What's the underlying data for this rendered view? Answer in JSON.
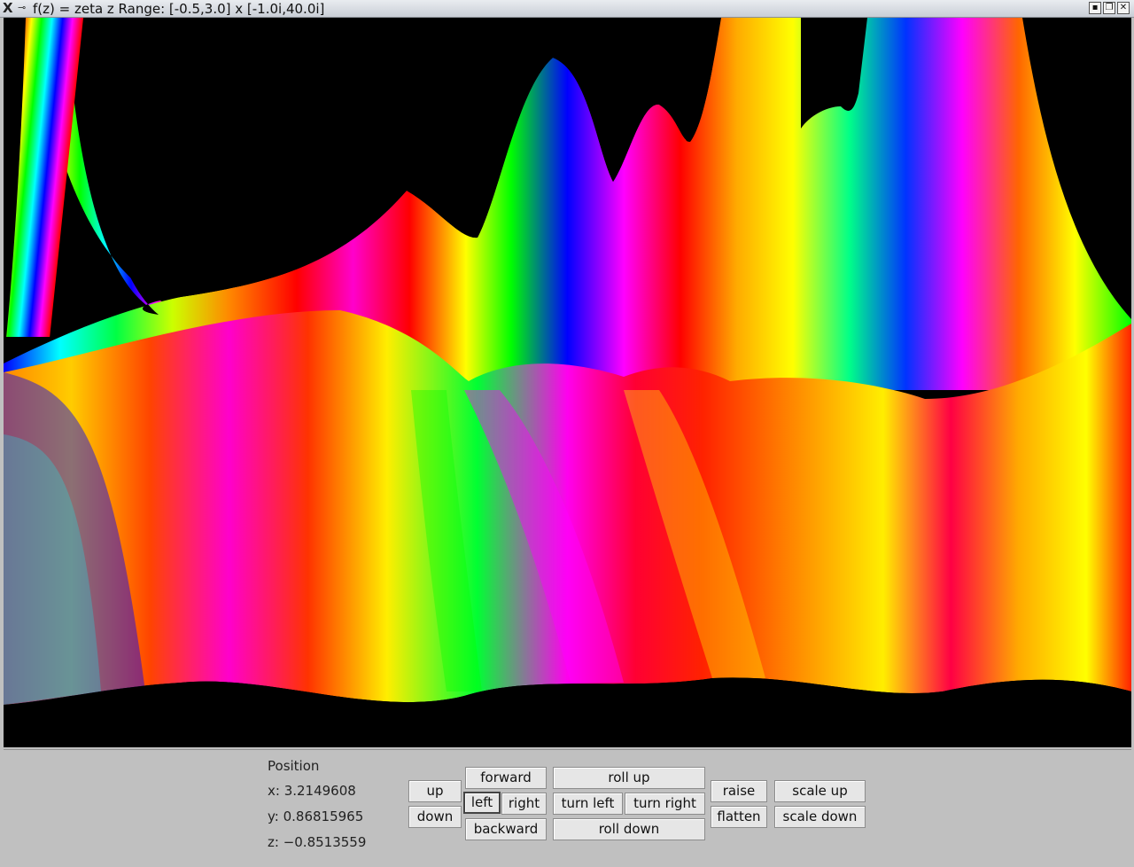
{
  "window": {
    "title": "f(z) = zeta z    Range: [-0.5,3.0] x [-1.0i,40.0i]",
    "controls": [
      "minimize",
      "maximize",
      "close"
    ]
  },
  "position": {
    "label": "Position",
    "x": "x: 3.2149608",
    "y": "y: 0.86815965",
    "z": "z: −0.8513559"
  },
  "buttons": {
    "up": "up",
    "down": "down",
    "forward": "forward",
    "left": "left",
    "right": "right",
    "backward": "backward",
    "roll_up": "roll up",
    "turn_left": "turn left",
    "turn_right": "turn right",
    "roll_down": "roll down",
    "raise": "raise",
    "flatten": "flatten",
    "scale_up": "scale up",
    "scale_down": "scale down"
  },
  "focused_button": "left"
}
